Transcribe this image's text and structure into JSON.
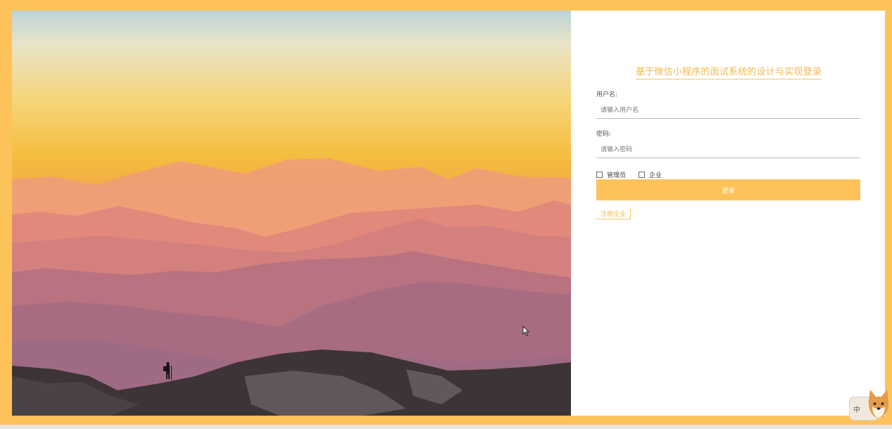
{
  "colors": {
    "accent": "#FDC35A",
    "title": "#F2B84C",
    "background": "#FFFFFF"
  },
  "login": {
    "title": "基于微信小程序的面试系统的设计与实现登录",
    "username_label": "用户名:",
    "username_placeholder": "请输入用户名",
    "username_value": "",
    "password_label": "密码:",
    "password_placeholder": "请输入密码",
    "password_value": "",
    "roles": [
      {
        "label": "管理员",
        "checked": false
      },
      {
        "label": "企业",
        "checked": false
      }
    ],
    "submit_label": "登录",
    "register_label": "注册企业"
  },
  "hero": {
    "icon": "mountain-sunset-photo"
  },
  "badge": {
    "text": "中"
  }
}
